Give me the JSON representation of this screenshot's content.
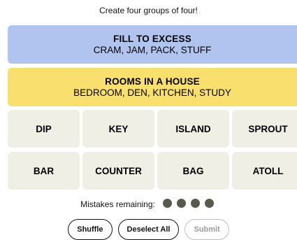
{
  "instructions": "Create four groups of four!",
  "solved_groups": [
    {
      "title": "FILL TO EXCESS",
      "words": "CRAM, JAM, PACK, STUFF",
      "color": "#b0c4ef"
    },
    {
      "title": "ROOMS IN A HOUSE",
      "words": "BEDROOM, DEN, KITCHEN, STUDY",
      "color": "#f9df6d"
    }
  ],
  "tiles": [
    "DIP",
    "KEY",
    "ISLAND",
    "SPROUT",
    "BAR",
    "COUNTER",
    "BAG",
    "ATOLL"
  ],
  "mistakes": {
    "label": "Mistakes remaining:",
    "remaining": 4
  },
  "buttons": {
    "shuffle": "Shuffle",
    "deselect_all": "Deselect All",
    "submit": "Submit"
  }
}
